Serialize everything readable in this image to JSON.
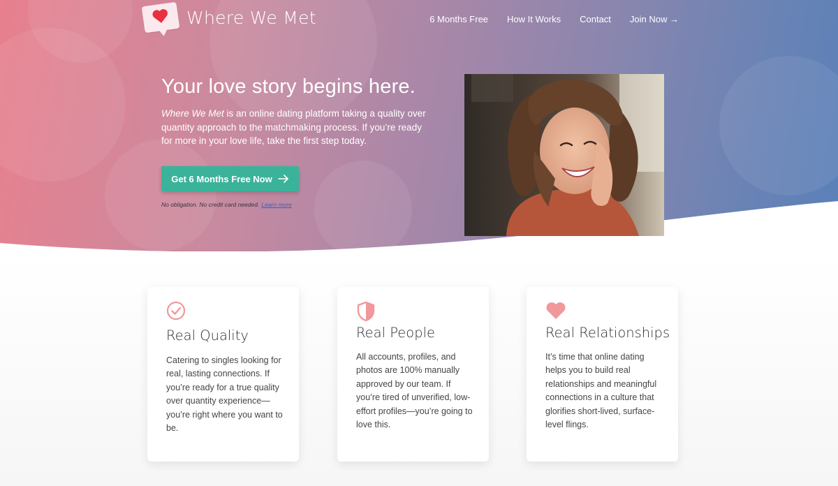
{
  "brand": {
    "name": "Where We Met",
    "logo_icon": "heart-chat-bubble-icon",
    "accent": "#e8303f"
  },
  "nav": {
    "items": [
      "6 Months Free",
      "How It Works",
      "Contact",
      "Join Now →"
    ]
  },
  "hero": {
    "title": "Your love story begins here.",
    "desc_brand": "Where We Met",
    "desc_rest": " is an online dating platform taking a quality over quantity approach to the matchmaking process. If you’re ready for more in your love life, take the first step today.",
    "cta_label": "Get 6 Months Free Now",
    "cta_icon": "arrow-right-icon",
    "cta_color": "#3bb39a",
    "fine_print": "No obligation. No credit card needed.",
    "learn_more": "Learn more",
    "gradient_start": "#e8808e",
    "gradient_end": "#5a80b8"
  },
  "features": [
    {
      "icon": "check-circle-icon",
      "title": "Real Quality",
      "body": "Catering to singles looking for real, lasting connections. If you’re ready for a true quality over quantity experience—you’re right where you want to be."
    },
    {
      "icon": "shield-icon",
      "title": "Real People",
      "body": "All accounts, profiles, and photos are 100% manually approved by our team. If you’re tired of unverified, low-effort profiles—you’re going to love this."
    },
    {
      "icon": "heart-icon",
      "title": "Real Relationships",
      "body": "It’s time that online dating helps you to build real relationships and meaningful connections in a culture that glorifies short-lived, surface-level flings."
    }
  ],
  "icon_color": "#f0989c"
}
